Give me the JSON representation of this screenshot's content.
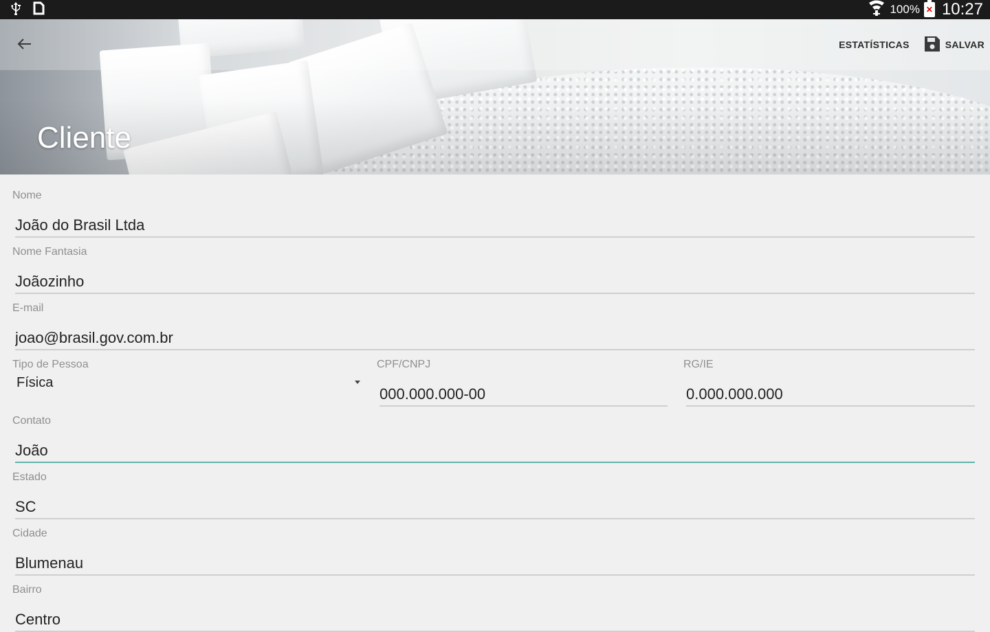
{
  "status_bar": {
    "battery_percent": "100%",
    "time": "10:27",
    "icons": [
      "usb-icon",
      "notification-icon",
      "wifi-icon",
      "battery-icon"
    ]
  },
  "toolbar": {
    "back_icon": "arrow-left-icon",
    "statistics_label": "ESTATÍSTICAS",
    "save_label": "SALVAR",
    "save_icon": "floppy-disk-icon"
  },
  "page": {
    "title": "Cliente"
  },
  "form": {
    "nome": {
      "label": "Nome",
      "value": "João do Brasil Ltda"
    },
    "nome_fantasia": {
      "label": "Nome Fantasia",
      "value": "Joãozinho"
    },
    "email": {
      "label": "E-mail",
      "value": "joao@brasil.gov.com.br"
    },
    "tipo_pessoa": {
      "label": "Tipo de Pessoa",
      "value": "Física"
    },
    "cpf_cnpj": {
      "label": "CPF/CNPJ",
      "value": "000.000.000-00"
    },
    "rg_ie": {
      "label": "RG/IE",
      "value": "0.000.000.000"
    },
    "contato": {
      "label": "Contato",
      "value": "João"
    },
    "estado": {
      "label": "Estado",
      "value": "SC"
    },
    "cidade": {
      "label": "Cidade",
      "value": "Blumenau"
    },
    "bairro": {
      "label": "Bairro",
      "value": "Centro"
    }
  },
  "colors": {
    "status_bar_bg": "#1b1b1b",
    "page_bg": "#f0f0f0",
    "focused_underline": "#5fb3a8",
    "underline": "#cfcfcf",
    "label": "#8f8f8f"
  }
}
